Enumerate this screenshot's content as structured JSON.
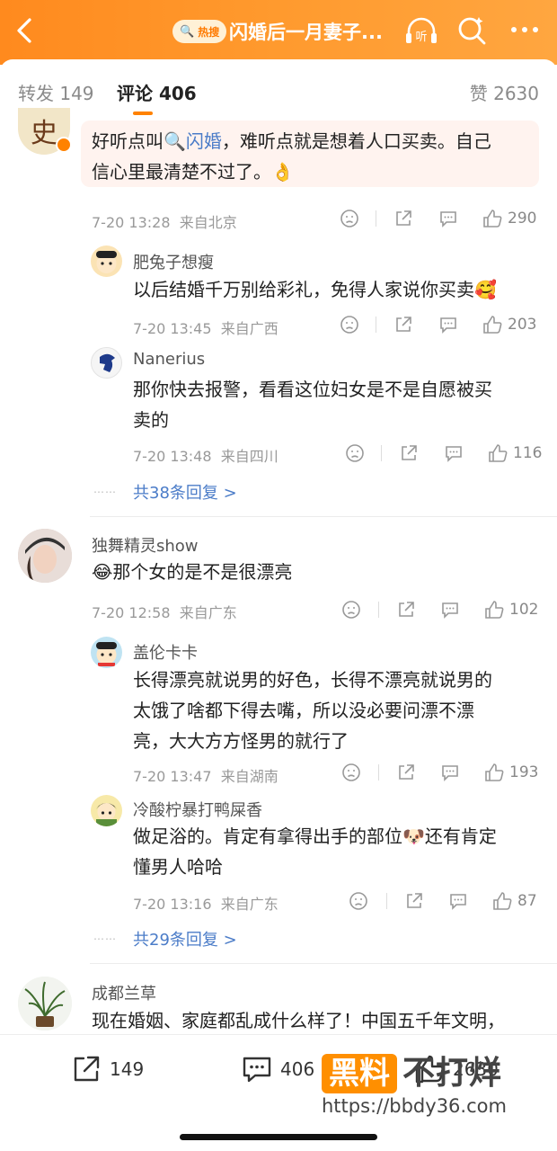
{
  "header": {
    "hot_badge": "热搜",
    "title": "闪婚后一月妻子...",
    "listen_label": "听"
  },
  "tabs": {
    "repost": "转发 149",
    "comments": "评论 406",
    "likes": "赞 2630"
  },
  "comments": [
    {
      "text_before": "好听点叫",
      "topic_link": "闪婚",
      "text_after": "，难听点就是想着人口买卖。自己",
      "line2": "信心里最清楚不过了。👌",
      "time": "7-20 13:28",
      "location": "来自北京",
      "likes": "290",
      "replies": [
        {
          "user": "肥兔子想瘦",
          "text": "以后结婚千万别给彩礼，免得人家说你买卖🥰",
          "time": "7-20 13:45",
          "location": "来自广西",
          "likes": "203"
        },
        {
          "user": "Nanerius",
          "line1": "那你快去报警，看看这位妇女是不是自愿被买",
          "line2": "卖的",
          "time": "7-20 13:48",
          "location": "来自四川",
          "likes": "116"
        }
      ],
      "more_replies": "共38条回复 >"
    },
    {
      "user": "独舞精灵show",
      "text": "😂那个女的是不是很漂亮",
      "time": "7-20 12:58",
      "location": "来自广东",
      "likes": "102",
      "replies": [
        {
          "user": "盖伦卡卡",
          "line1": "长得漂亮就说男的好色，长得不漂亮就说男的",
          "line2": "太饿了啥都下得去嘴，所以没必要问漂不漂",
          "line3": "亮，大大方方怪男的就行了",
          "time": "7-20 13:47",
          "location": "来自湖南",
          "likes": "193"
        },
        {
          "user": "冷酸柠暴打鸭屎香",
          "line1": "做足浴的。肯定有拿得出手的部位🐶还有肯定",
          "line2": "懂男人哈哈",
          "time": "7-20 13:16",
          "location": "来自广东",
          "likes": "87"
        }
      ],
      "more_replies": "共29条回复 >"
    },
    {
      "user": "成都兰草",
      "text": "现在婚姻、家庭都乱成什么样了！中国五千年文明，"
    }
  ],
  "dots": "……",
  "bottom_bar": {
    "repost_count": "149",
    "comment_count": "406",
    "like_count": "2630"
  },
  "watermark": {
    "box_text": "黑料",
    "text": "不打烊",
    "url": "https://bbdy36.com"
  },
  "colors": {
    "header_orange": "#ff8a1e",
    "accent": "#ff8200",
    "link": "#4b7cc8"
  }
}
